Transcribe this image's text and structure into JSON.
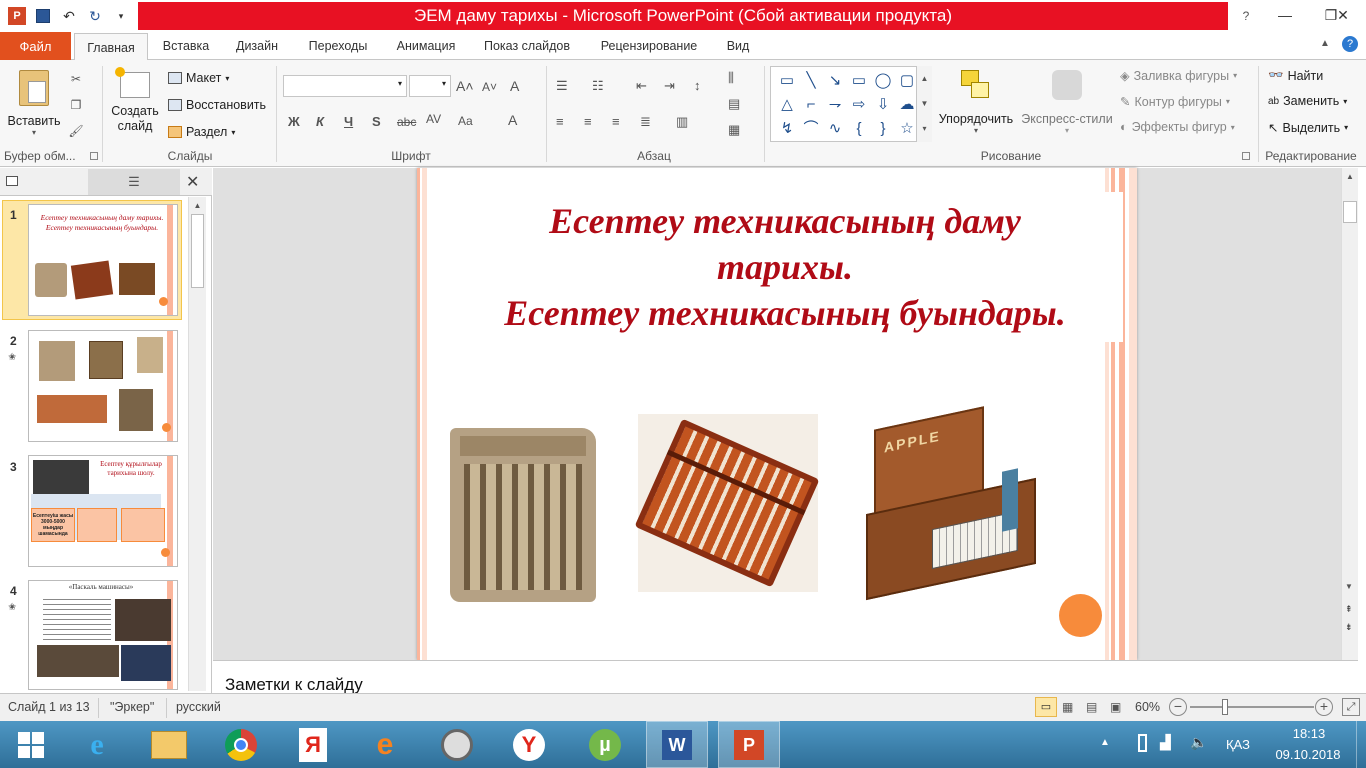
{
  "window": {
    "title": "ЭЕМ даму тарихы  -  Microsoft PowerPoint (Сбой активации продукта)"
  },
  "tabs": [
    "Файл",
    "Главная",
    "Вставка",
    "Дизайн",
    "Переходы",
    "Анимация",
    "Показ слайдов",
    "Рецензирование",
    "Вид"
  ],
  "ribbon": {
    "clipboard": {
      "paste": "Вставить",
      "label": "Буфер обм..."
    },
    "slides": {
      "create": "Создать слайд",
      "layout": "Макет",
      "reset": "Восстановить",
      "section": "Раздел",
      "label": "Слайды"
    },
    "font": {
      "label": "Шрифт",
      "bold": "Ж",
      "italic": "К",
      "underline": "Ч",
      "strike": "S",
      "abc": "abc"
    },
    "paragraph": {
      "label": "Абзац"
    },
    "drawing": {
      "arrange": "Упорядочить",
      "quickstyles": "Экспресс-стили",
      "fill": "Заливка фигуры",
      "outline": "Контур фигуры",
      "effects": "Эффекты фигур",
      "label": "Рисование"
    },
    "editing": {
      "find": "Найти",
      "replace": "Заменить",
      "select": "Выделить",
      "label": "Редактирование"
    }
  },
  "slide": {
    "title_line1": "Есептеу техникасының даму",
    "title_line2": "тарихы.",
    "title_line3": "Есептеу техникасының буындары."
  },
  "thumbnails": [
    {
      "num": "1",
      "text": "Есептеу техникасының даму тарихы. Есептеу техникасының буындары."
    },
    {
      "num": "2",
      "text": ""
    },
    {
      "num": "3",
      "text": "Есептеу құрылғылар тарихына шолу.",
      "box1": "Есептеуіш жасы 3000-5000 мыңдар шамасында"
    },
    {
      "num": "4",
      "text": "«Паскаль машинасы»"
    }
  ],
  "notes": {
    "placeholder": "Заметки к слайду"
  },
  "status": {
    "slide": "Слайд 1 из 13",
    "theme": "\"Эркер\"",
    "lang": "русский",
    "zoom": "60%"
  },
  "taskbar": {
    "lang": "ҚАЗ",
    "time": "18:13",
    "date": "09.10.2018"
  }
}
